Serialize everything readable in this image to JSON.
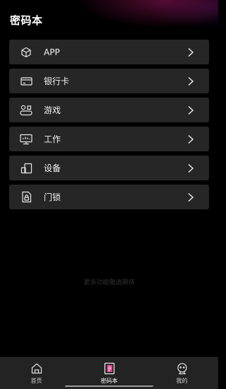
{
  "header": {
    "title": "密码本"
  },
  "categories": [
    {
      "label": "APP",
      "icon": "cube-icon"
    },
    {
      "label": "银行卡",
      "icon": "credit-card-icon"
    },
    {
      "label": "游戏",
      "icon": "gamepad-icon"
    },
    {
      "label": "工作",
      "icon": "monitor-icon"
    },
    {
      "label": "设备",
      "icon": "devices-icon"
    },
    {
      "label": "门锁",
      "icon": "door-lock-icon"
    }
  ],
  "more_text": "更多功能敬请期待",
  "tabbar": {
    "tabs": [
      {
        "label": "首页",
        "icon": "home-icon",
        "active": false
      },
      {
        "label": "密码本",
        "icon": "notebook-icon",
        "active": true
      },
      {
        "label": "我的",
        "icon": "profile-icon",
        "active": false
      }
    ]
  },
  "colors": {
    "accent": "#e23a8e",
    "item_bg": "#262626",
    "background": "#000000"
  }
}
